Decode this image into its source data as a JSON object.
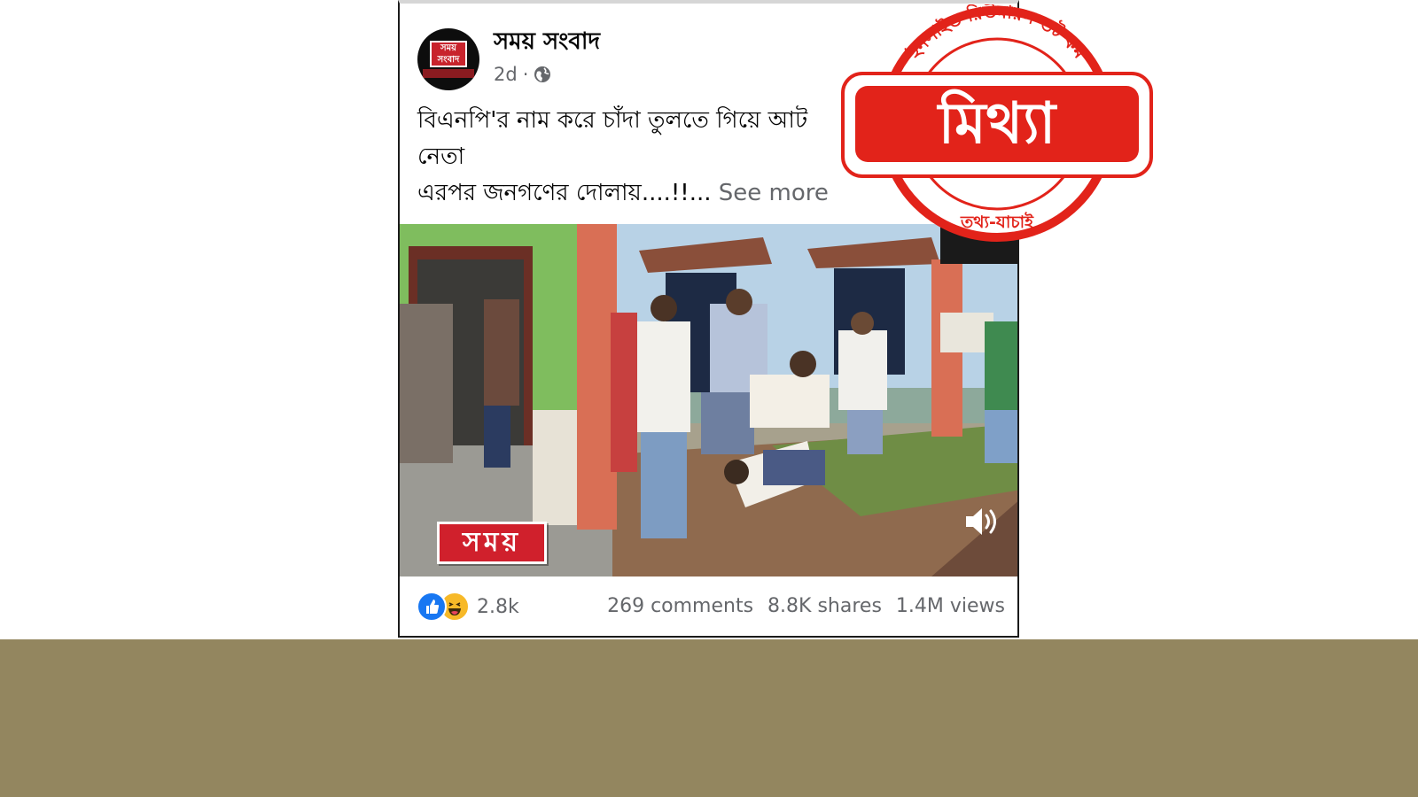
{
  "post": {
    "page_name": "সময় সংবাদ",
    "time": "2d",
    "separator": "·",
    "more": "···",
    "caption_line1": "বিএনপি'র  নাম করে চাঁদা  তুলতে গিয়ে আট",
    "caption_line2": "নেতা",
    "caption_line3": "এরপর জনগণের দোলায়....!!...",
    "see_more": "See more",
    "channel_logo": "সময়",
    "avatar_text": "সময় সংবাদ",
    "reactions_count": "2.8k",
    "comments": "269 comments",
    "shares": "8.8K shares",
    "views": "1.4M views",
    "reaction_icons": [
      "like-icon",
      "haha-icon"
    ]
  },
  "stamp": {
    "label": "মিথ্যা",
    "arc_text": "ইনসাইড রিউমারস ভট কম",
    "bottom_text": "তথ্য-যাচাই",
    "color": "#e2231a"
  },
  "colors": {
    "bottom_band": "#93865f",
    "link_gray": "#65676b",
    "fb_blue": "#1877f2"
  }
}
